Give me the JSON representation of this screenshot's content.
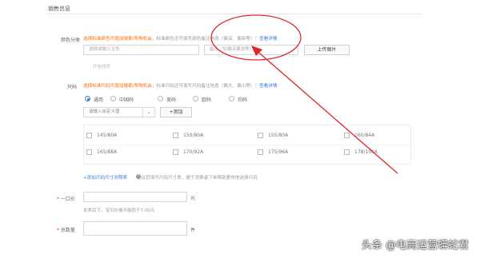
{
  "section_title": "销售信息",
  "color": {
    "label": "颜色分类",
    "warning": "选择标准颜色可增加搜索/导购机会",
    "hint": "，标准颜色还可填写颜色备注信息（偏深、偏亮等）！",
    "link": "查看详情",
    "main_color_placeholder": "选择或输入主色",
    "remark_placeholder": "备注（如偏深偏浅等）",
    "upload_label": "上传图片",
    "sub_hint": "开始排序"
  },
  "size": {
    "label": "尺码",
    "warning": "选择标准尺码可增加搜索/导购机会",
    "hint": "，标准尺码还可填写尺码备注信息（偏大、偏小等）！",
    "link": "查看详情",
    "types": [
      "通用",
      "中国码",
      "美码",
      "欧码",
      "均码"
    ],
    "custom_placeholder": "请输入自定义值",
    "add_label": "+添加",
    "values": [
      "145/80A",
      "150/80A",
      "155/80A",
      "160/84A",
      "165/88A",
      "170/92A",
      "175/96A",
      "178/100A"
    ],
    "table_link": "+添加尺码尺寸对照表",
    "table_hint": "建议您填写尺码尺寸表，便于消费者下单帮助更快地选择尺码"
  },
  "price": {
    "label": "一口价",
    "unit": "元",
    "hint": "本类目下，宝贝价格不能低于7.00元"
  },
  "quantity": {
    "label": "总数量",
    "unit": "件"
  },
  "watermark": "头条 @电商运营蟒蛇君",
  "colors": {
    "accent": "#3a7bd5",
    "warning": "#ff6a00",
    "annotation": "#e0262b"
  }
}
